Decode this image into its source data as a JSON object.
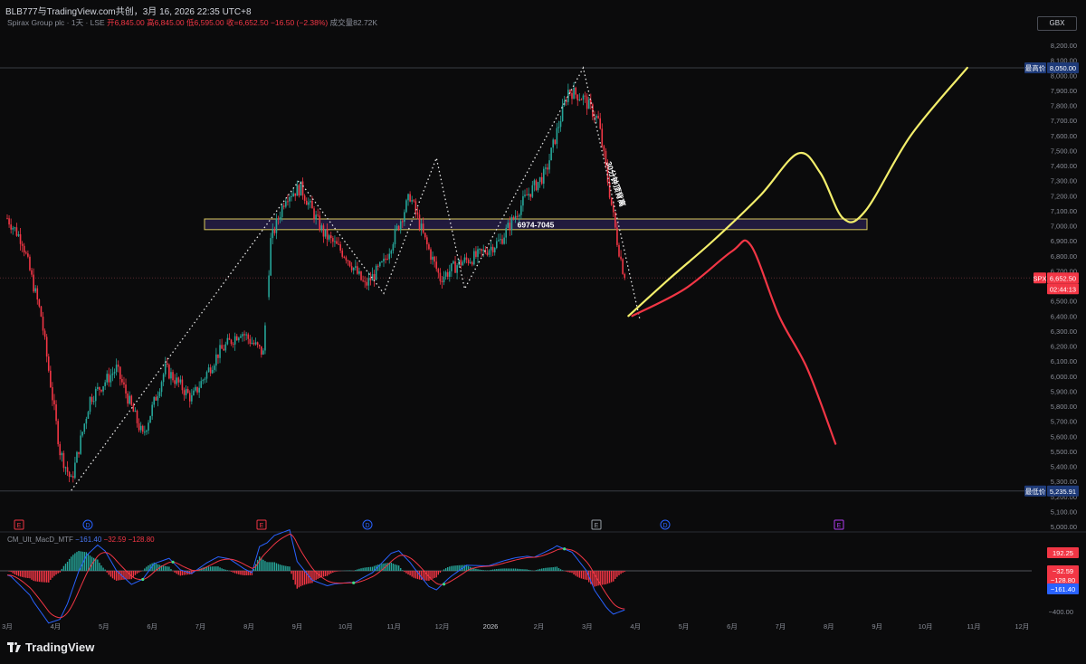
{
  "header": {
    "text": "BLB777与TradingView.com共创，3月 16, 2026 22:35 UTC+8"
  },
  "legend": {
    "symbol": "Spirax Group plc · 1天 · LSE",
    "open": "开6,845.00",
    "high": "高6,845.00",
    "low": "低6,595.00",
    "close": "收=6,652.50",
    "change": "−16.50 (−2.38%)",
    "volume": "成交量82.72K"
  },
  "currency": "GBX",
  "colors": {
    "up": "#26a69a",
    "down": "#f23645",
    "yellow": "#f3ee6b",
    "red_forecast": "#f23645",
    "zone_fill": "#2e2358",
    "zone_border": "#d9c85a",
    "macd_line": "#2962ff",
    "signal_line": "#f23645"
  },
  "labels": {
    "zone": "6974-7045",
    "vertical_note": "30分钟顶背离",
    "high_tag": "最高价",
    "high_value": "8,050.00",
    "low_tag": "最低价",
    "low_value": "5,235.91",
    "price_tag": "SPX",
    "price_value": "6,652.50",
    "countdown": "02:44:13",
    "logo": "TradingView"
  },
  "macd_legend": {
    "title": "CM_Ult_MacD_MTF",
    "v1": "−161.40",
    "v2": "−32.59",
    "v3": "−128.80"
  },
  "macd_tags": [
    "192.25",
    "−32.59",
    "−128.80",
    "−161.40"
  ],
  "macd_axis_label": "−400.00",
  "event_markers": [
    {
      "label": "E",
      "color": "#f23645"
    },
    {
      "label": "D",
      "color": "#2962ff"
    },
    {
      "label": "E",
      "color": "#f23645"
    },
    {
      "label": "D",
      "color": "#2962ff"
    },
    {
      "label": "E",
      "color": "#9aa0a8"
    },
    {
      "label": "D",
      "color": "#2962ff"
    },
    {
      "label": "E",
      "color": "#b03cf0"
    }
  ],
  "chart_data": {
    "type": "candlestick",
    "y_ticks": [
      "8,200.00",
      "8,100.00",
      "8,000.00",
      "7,900.00",
      "7,800.00",
      "7,700.00",
      "7,600.00",
      "7,500.00",
      "7,400.00",
      "7,300.00",
      "7,200.00",
      "7,100.00",
      "7,000.00",
      "6,900.00",
      "6,800.00",
      "6,700.00",
      "6,600.00",
      "6,500.00",
      "6,400.00",
      "6,300.00",
      "6,200.00",
      "6,100.00",
      "6,000.00",
      "5,900.00",
      "5,800.00",
      "5,700.00",
      "5,600.00",
      "5,500.00",
      "5,400.00",
      "5,300.00",
      "5,200.00",
      "5,100.00",
      "5,000.00"
    ],
    "y_range": [
      4950,
      8250
    ],
    "x_ticks": [
      "3月",
      "4月",
      "5月",
      "6月",
      "7月",
      "8月",
      "9月",
      "10月",
      "11月",
      "12月",
      "2026",
      "2月",
      "3月",
      "4月",
      "5月",
      "6月",
      "7月",
      "8月",
      "9月",
      "10月",
      "11月",
      "12月"
    ],
    "path_anchors": [
      {
        "t": 0,
        "price": 7050
      },
      {
        "t": 8,
        "price": 6900
      },
      {
        "t": 18,
        "price": 6400
      },
      {
        "t": 28,
        "price": 5500
      },
      {
        "t": 34,
        "price": 5300
      },
      {
        "t": 44,
        "price": 5850
      },
      {
        "t": 58,
        "price": 6050
      },
      {
        "t": 72,
        "price": 5600
      },
      {
        "t": 84,
        "price": 6050
      },
      {
        "t": 98,
        "price": 5850
      },
      {
        "t": 112,
        "price": 6150
      },
      {
        "t": 124,
        "price": 6300
      },
      {
        "t": 136,
        "price": 6150
      },
      {
        "t": 140,
        "price": 6900
      },
      {
        "t": 148,
        "price": 7200
      },
      {
        "t": 156,
        "price": 7250
      },
      {
        "t": 168,
        "price": 6950
      },
      {
        "t": 180,
        "price": 6800
      },
      {
        "t": 190,
        "price": 6600
      },
      {
        "t": 200,
        "price": 6750
      },
      {
        "t": 214,
        "price": 7200
      },
      {
        "t": 222,
        "price": 6900
      },
      {
        "t": 230,
        "price": 6650
      },
      {
        "t": 240,
        "price": 6750
      },
      {
        "t": 250,
        "price": 6800
      },
      {
        "t": 262,
        "price": 6900
      },
      {
        "t": 276,
        "price": 7200
      },
      {
        "t": 286,
        "price": 7350
      },
      {
        "t": 298,
        "price": 7900
      },
      {
        "t": 306,
        "price": 7850
      },
      {
        "t": 314,
        "price": 7700
      },
      {
        "t": 324,
        "price": 6900
      },
      {
        "t": 328,
        "price": 6652
      }
    ],
    "last_close": 6652.5,
    "period_high": 8050,
    "period_low": 5235.91,
    "zone": [
      6974,
      7045
    ],
    "yellow_projection": [
      {
        "t": 330,
        "price": 6400
      },
      {
        "t": 352,
        "price": 6650
      },
      {
        "t": 375,
        "price": 6900
      },
      {
        "t": 400,
        "price": 7200
      },
      {
        "t": 420,
        "price": 7480
      },
      {
        "t": 432,
        "price": 7350
      },
      {
        "t": 444,
        "price": 7050
      },
      {
        "t": 456,
        "price": 7100
      },
      {
        "t": 480,
        "price": 7600
      },
      {
        "t": 510,
        "price": 8050
      }
    ],
    "red_projection": [
      {
        "t": 332,
        "price": 6400
      },
      {
        "t": 360,
        "price": 6580
      },
      {
        "t": 385,
        "price": 6830
      },
      {
        "t": 395,
        "price": 6870
      },
      {
        "t": 410,
        "price": 6400
      },
      {
        "t": 425,
        "price": 6050
      },
      {
        "t": 440,
        "price": 5550
      }
    ],
    "zigzag": [
      {
        "t": 34,
        "price": 5240
      },
      {
        "t": 155,
        "price": 7300
      },
      {
        "t": 200,
        "price": 6550
      },
      {
        "t": 228,
        "price": 7450
      },
      {
        "t": 243,
        "price": 6580
      },
      {
        "t": 306,
        "price": 8050
      },
      {
        "t": 336,
        "price": 6380
      }
    ]
  }
}
